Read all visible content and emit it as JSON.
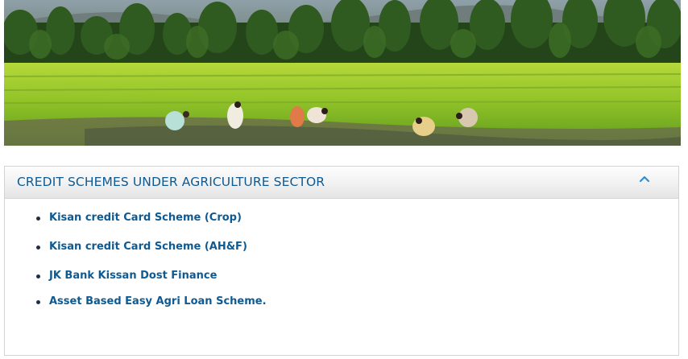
{
  "banner": {
    "image_description_icon": "farm-field-image"
  },
  "panel": {
    "title": "CREDIT SCHEMES UNDER AGRICULTURE SECTOR",
    "collapse_icon": "chevron-up-icon",
    "accent_color": "#0e5a93",
    "items": [
      {
        "label": "Kisan credit Card Scheme (Crop)"
      },
      {
        "label": "Kisan credit Card Scheme (AH&F)"
      },
      {
        "label": "JK Bank Kissan Dost Finance"
      },
      {
        "label": "Asset Based Easy Agri Loan Scheme."
      }
    ]
  }
}
